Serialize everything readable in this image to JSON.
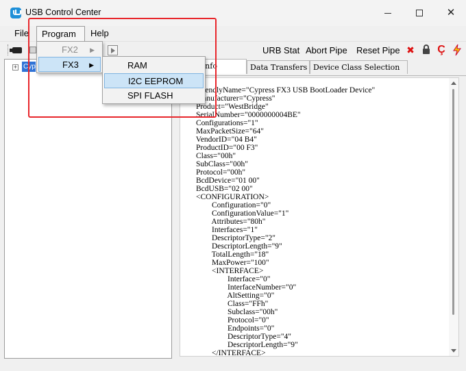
{
  "window": {
    "title": "USB Control Center"
  },
  "menubar": {
    "items": [
      "File",
      "Program",
      "Help"
    ]
  },
  "program_menu": {
    "items": [
      {
        "label": "FX2",
        "enabled": false,
        "has_submenu": true
      },
      {
        "label": "FX3",
        "enabled": true,
        "has_submenu": true,
        "highlighted": true
      }
    ]
  },
  "fx3_submenu": {
    "items": [
      {
        "label": "RAM"
      },
      {
        "label": "I2C EEPROM",
        "highlighted": true
      },
      {
        "label": "SPI FLASH"
      }
    ]
  },
  "toolbar": {
    "urb_stat": "URB Stat",
    "abort_pipe": "Abort Pipe",
    "reset_pipe": "Reset Pipe",
    "icons": [
      "camera-icon",
      "stop-icon",
      "play-icon",
      "x-icon",
      "lock-icon",
      "c-icon",
      "lightning-icon"
    ]
  },
  "tree": {
    "expander": "+",
    "selected_node": "Cyp"
  },
  "tabs": [
    {
      "label": "ptor Info",
      "active": true
    },
    {
      "label": "Data Transfers",
      "active": false
    },
    {
      "label": "Device Class Selection",
      "active": false
    }
  ],
  "descriptor_lines": [
    "<DE>",
    "        FriendlyName=\"Cypress FX3 USB BootLoader Device\"",
    "        Manufacturer=\"Cypress\"",
    "        Product=\"WestBridge\"",
    "        SerialNumber=\"0000000004BE\"",
    "        Configurations=\"1\"",
    "        MaxPacketSize=\"64\"",
    "        VendorID=\"04 B4\"",
    "        ProductID=\"00 F3\"",
    "        Class=\"00h\"",
    "        SubClass=\"00h\"",
    "        Protocol=\"00h\"",
    "        BcdDevice=\"01 00\"",
    "        BcdUSB=\"02 00\"",
    "        <CONFIGURATION>",
    "                Configuration=\"0\"",
    "                ConfigurationValue=\"1\"",
    "                Attributes=\"80h\"",
    "                Interfaces=\"1\"",
    "                DescriptorType=\"2\"",
    "                DescriptorLength=\"9\"",
    "                TotalLength=\"18\"",
    "                MaxPower=\"100\"",
    "                <INTERFACE>",
    "                        Interface=\"0\"",
    "                        InterfaceNumber=\"0\"",
    "                        AltSetting=\"0\"",
    "                        Class=\"FFh\"",
    "                        Subclass=\"00h\"",
    "                        Protocol=\"0\"",
    "                        Endpoints=\"0\"",
    "                        DescriptorType=\"4\"",
    "                        DescriptorLength=\"9\"",
    "                </INTERFACE>"
  ],
  "colors": {
    "annotation": "#e8262b",
    "highlight": "#cce4f7",
    "selection": "#3073d6"
  }
}
